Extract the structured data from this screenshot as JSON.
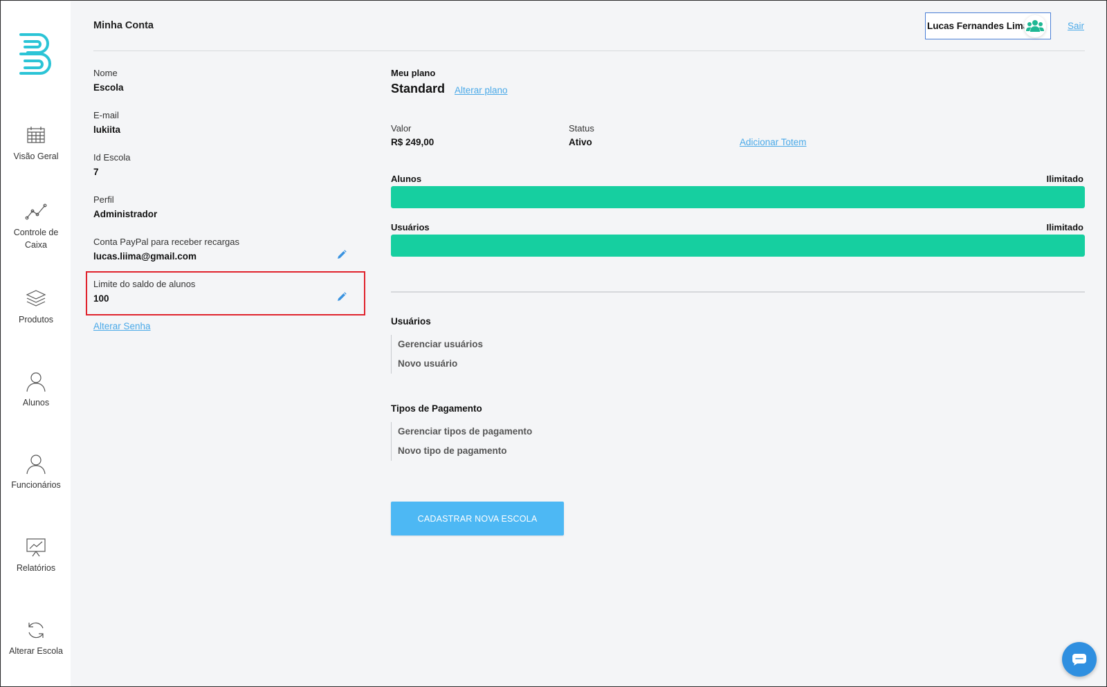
{
  "header": {
    "title": "Minha Conta",
    "user_name": "Lucas Fernandes Lima",
    "logout_label": "Sair"
  },
  "sidebar": {
    "items": [
      {
        "label": "Visão Geral",
        "icon": "calendar-icon"
      },
      {
        "label": "Controle de Caixa",
        "icon": "line-chart-icon"
      },
      {
        "label": "Produtos",
        "icon": "layers-icon"
      },
      {
        "label": "Alunos",
        "icon": "person-icon"
      },
      {
        "label": "Funcionários",
        "icon": "person-icon"
      },
      {
        "label": "Relatórios",
        "icon": "presentation-chart-icon"
      },
      {
        "label": "Alterar Escola",
        "icon": "refresh-icon"
      }
    ]
  },
  "account": {
    "nome_label": "Nome",
    "nome_value": "Escola",
    "email_label": "E-mail",
    "email_value": "lukiita",
    "id_label": "Id Escola",
    "id_value": "7",
    "perfil_label": "Perfil",
    "perfil_value": "Administrador",
    "paypal_label": "Conta PayPal para receber recargas",
    "paypal_value": "lucas.liima@gmail.com",
    "limite_label": "Limite do saldo de alunos",
    "limite_value": "100",
    "change_password_link": "Alterar Senha"
  },
  "plan": {
    "heading": "Meu plano",
    "name": "Standard",
    "change_link": "Alterar plano",
    "valor_label": "Valor",
    "valor_value": "R$ 249,00",
    "status_label": "Status",
    "status_value": "Ativo",
    "add_totem_link": "Adicionar Totem",
    "alunos_label": "Alunos",
    "alunos_limit": "Ilimitado",
    "alunos_fill": 1.0,
    "usuarios_label": "Usuários",
    "usuarios_limit": "Ilimitado",
    "usuarios_fill": 1.0
  },
  "sections": {
    "usuarios_title": "Usuários",
    "usuarios_items": [
      "Gerenciar usuários",
      "Novo usuário"
    ],
    "pagamento_title": "Tipos de Pagamento",
    "pagamento_items": [
      "Gerenciar tipos de pagamento",
      "Novo tipo de pagamento"
    ]
  },
  "cta_label": "CADASTRAR NOVA ESCOLA",
  "colors": {
    "accent": "#4db8f4",
    "progress": "#16cfa0",
    "link": "#4aa9e8",
    "highlight": "#e0222c",
    "logo": "#2bc4d6"
  }
}
